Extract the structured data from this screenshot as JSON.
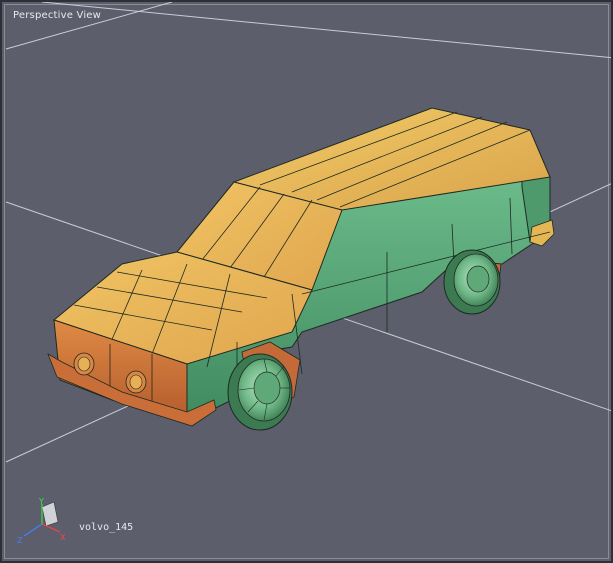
{
  "viewport": {
    "title": "Perspective View",
    "object_name": "volvo_145"
  },
  "axis_gizmo": {
    "x_label": "X",
    "y_label": "Y",
    "z_label": "Z"
  },
  "colors": {
    "background": "#5c5f6b",
    "grid_line": "#c9ccd6",
    "body_green": "#5aa878",
    "top_yellow": "#e4b654",
    "front_orange": "#d77b3e",
    "wheel_green": "#8fd0a0",
    "edge": "#1e2a22"
  }
}
